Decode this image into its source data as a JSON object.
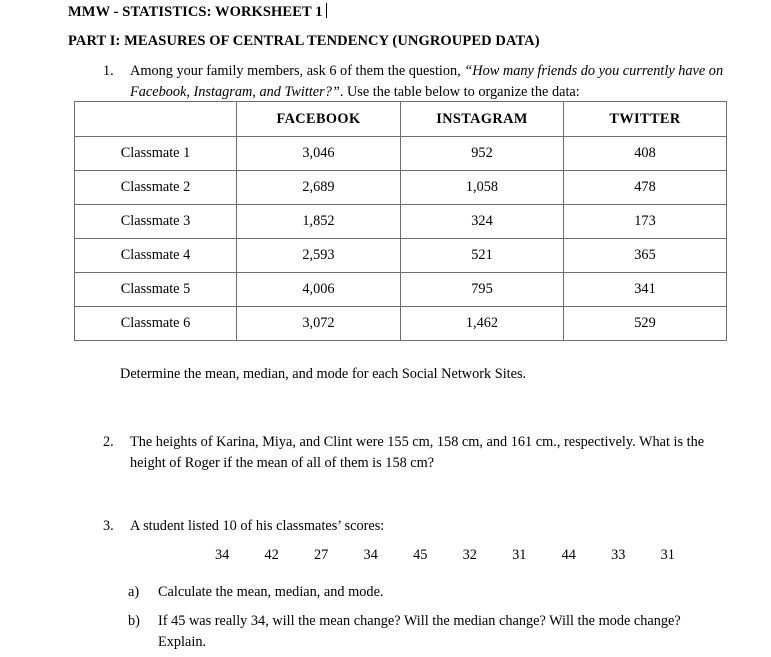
{
  "document": {
    "title": "MMW - STATISTICS: WORKSHEET 1",
    "part_title": "PART I: MEASURES OF CENTRAL TENDENCY (UNGROUPED DATA)"
  },
  "question1": {
    "number": "1.",
    "text_before_quote": "Among your family members, ask 6 of them the question, ",
    "quote": "“How many friends do you currently have on Facebook, Instagram, and Twitter?”",
    "text_after_quote": ". Use the table below to organize the data:",
    "follow_up": "Determine the mean, median, and mode for each Social Network Sites."
  },
  "table": {
    "corner_header": "",
    "headers": [
      "FACEBOOK",
      "INSTAGRAM",
      "TWITTER"
    ],
    "rows": [
      {
        "label": "Classmate 1",
        "facebook": "3,046",
        "instagram": "952",
        "twitter": "408"
      },
      {
        "label": "Classmate 2",
        "facebook": "2,689",
        "instagram": "1,058",
        "twitter": "478"
      },
      {
        "label": "Classmate 3",
        "facebook": "1,852",
        "instagram": "324",
        "twitter": "173"
      },
      {
        "label": "Classmate 4",
        "facebook": "2,593",
        "instagram": "521",
        "twitter": "365"
      },
      {
        "label": "Classmate 5",
        "facebook": "4,006",
        "instagram": "795",
        "twitter": "341"
      },
      {
        "label": "Classmate 6",
        "facebook": "3,072",
        "instagram": "1,462",
        "twitter": "529"
      }
    ]
  },
  "question2": {
    "number": "2.",
    "text": "The heights of Karina, Miya, and Clint were 155 cm, 158 cm, and 161 cm., respectively. What is the height of Roger if the mean of all of them is 158 cm?"
  },
  "question3": {
    "number": "3.",
    "text": "A student listed 10 of his classmates’ scores:",
    "scores": [
      "34",
      "42",
      "27",
      "34",
      "45",
      "32",
      "31",
      "44",
      "33",
      "31"
    ],
    "sub_items": [
      {
        "letter": "a)",
        "text": "Calculate the mean, median, and mode."
      },
      {
        "letter": "b)",
        "text": "If 45 was really 34, will the mean change? Will the median change? Will the mode change? Explain."
      }
    ]
  },
  "colors": {
    "text": "#000000",
    "page_background": "#ffffff",
    "table_border": "#6d6d6d"
  }
}
